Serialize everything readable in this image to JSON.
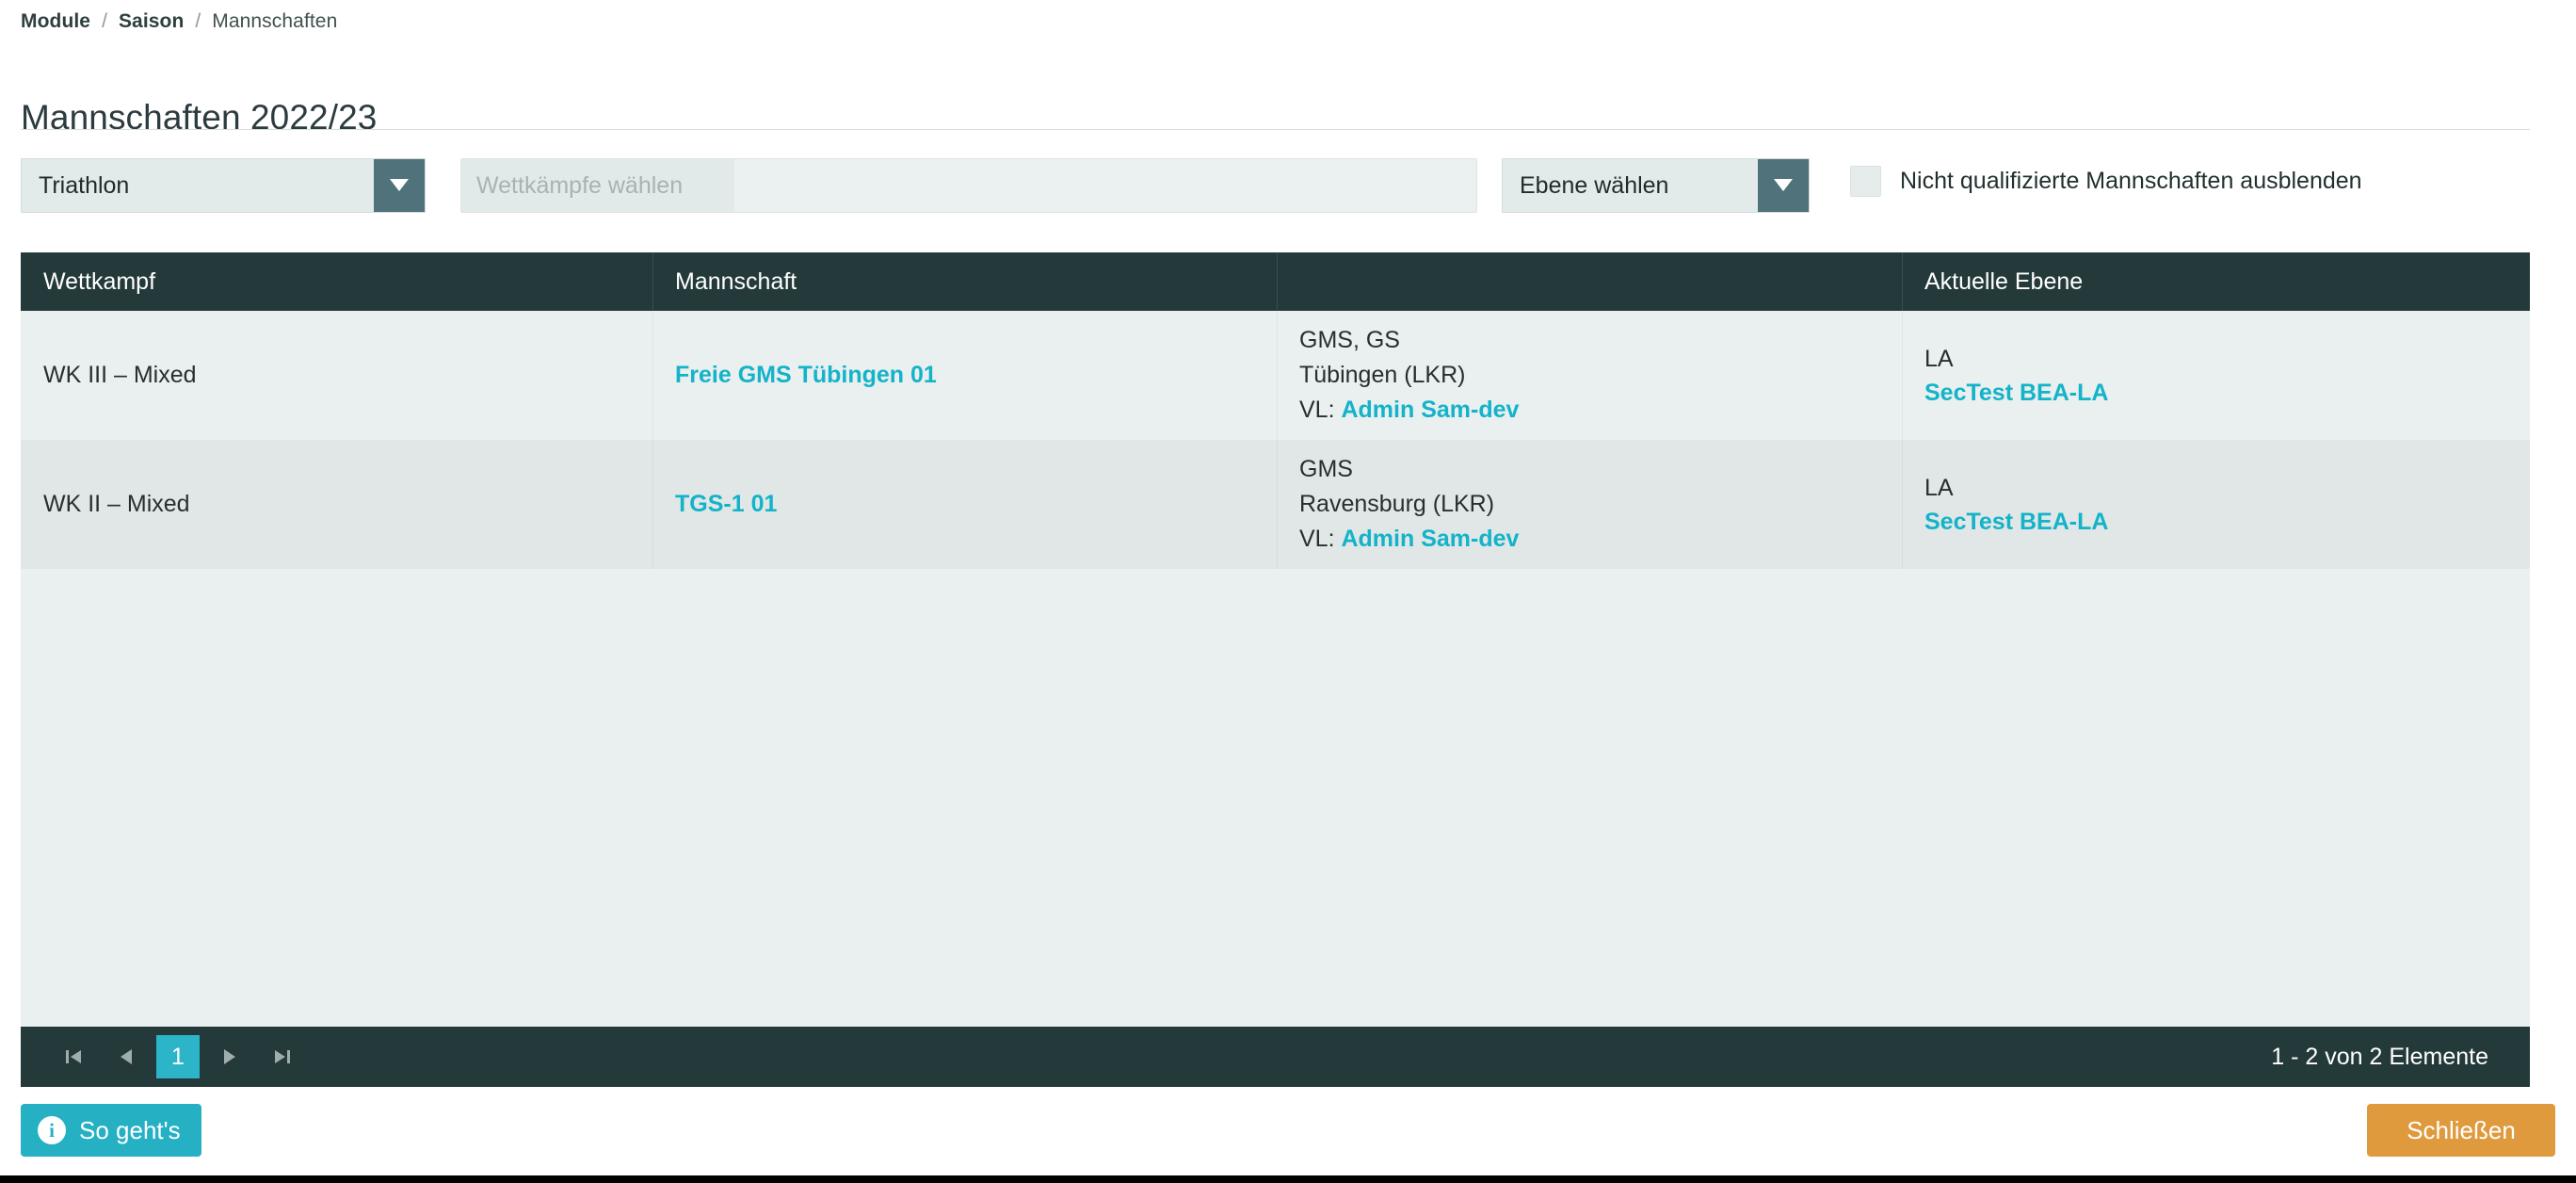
{
  "breadcrumb": {
    "items": [
      {
        "label": "Module"
      },
      {
        "label": "Saison"
      },
      {
        "label": "Mannschaften"
      }
    ],
    "separator": "/"
  },
  "page": {
    "title": "Mannschaften 2022/23"
  },
  "filters": {
    "sport_select": {
      "value": "Triathlon",
      "icon": "chevron-down-icon"
    },
    "competition_multiselect": {
      "placeholder": "Wettkämpfe wählen",
      "value": ""
    },
    "level_select": {
      "value": "Ebene wählen",
      "icon": "chevron-down-icon"
    },
    "hide_unqualified_checkbox": {
      "label": "Nicht qualifizierte Mannschaften ausblenden",
      "checked": false
    }
  },
  "table": {
    "columns": [
      {
        "label": "Wettkampf"
      },
      {
        "label": "Mannschaft"
      },
      {
        "label": ""
      },
      {
        "label": "Aktuelle Ebene"
      }
    ],
    "rows": [
      {
        "wettkampf": "WK III – Mixed",
        "mannschaft": "Freie GMS Tübingen 01",
        "school_types": "GMS, GS",
        "location": "Tübingen (LKR)",
        "vl_prefix": "VL:",
        "vl_name": "Admin Sam-dev",
        "ebene_code": "LA",
        "ebene_name": "SecTest BEA-LA"
      },
      {
        "wettkampf": "WK II – Mixed",
        "mannschaft": "TGS-1 01",
        "school_types": "GMS",
        "location": "Ravensburg (LKR)",
        "vl_prefix": "VL:",
        "vl_name": "Admin Sam-dev",
        "ebene_code": "LA",
        "ebene_name": "SecTest BEA-LA"
      }
    ]
  },
  "pagination": {
    "first_icon": "first-page-icon",
    "prev_icon": "previous-page-icon",
    "current_page": "1",
    "next_icon": "next-page-icon",
    "last_icon": "last-page-icon",
    "count_label": "1 - 2 von 2 Elemente"
  },
  "footer": {
    "howto_button": {
      "label": "So geht's",
      "icon": "info-icon"
    },
    "close_button": {
      "label": "Schließen"
    }
  },
  "colors": {
    "accent_cyan": "#13b3c9",
    "header_dark": "#24393a",
    "close_orange": "#e09a3e",
    "select_arrow": "#50727a"
  }
}
